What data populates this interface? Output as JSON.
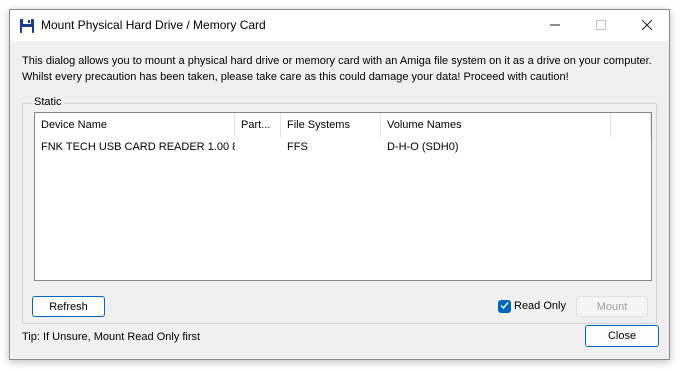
{
  "window": {
    "title": "Mount Physical Hard Drive / Memory Card",
    "icon": "floppy-disk-icon",
    "controls": {
      "minimize": "minimize-icon",
      "maximize": "maximize-icon",
      "close": "close-icon"
    }
  },
  "intro": {
    "line1": "This dialog allows you to mount a physical hard drive or memory card with an Amiga file system on it as a drive on your computer.",
    "line2": "Whilst every precaution has been taken, please take care as this could damage your data! Proceed with caution!"
  },
  "group": {
    "label": "Static",
    "columns": [
      "Device Name",
      "Part...",
      "File Systems",
      "Volume Names"
    ],
    "rows": [
      {
        "device": "FNK TECH USB CARD READER 1.00 8...",
        "partition": "",
        "file_system": "FFS",
        "volume": "D-H-O (SDH0)"
      }
    ],
    "refresh_label": "Refresh",
    "read_only_label": "Read Only",
    "read_only_checked": true,
    "mount_label": "Mount"
  },
  "tip": "Tip: If Unsure, Mount Read Only first",
  "close_label": "Close",
  "colors": {
    "accent": "#0067c0",
    "window_bg": "#f0f0f0"
  }
}
